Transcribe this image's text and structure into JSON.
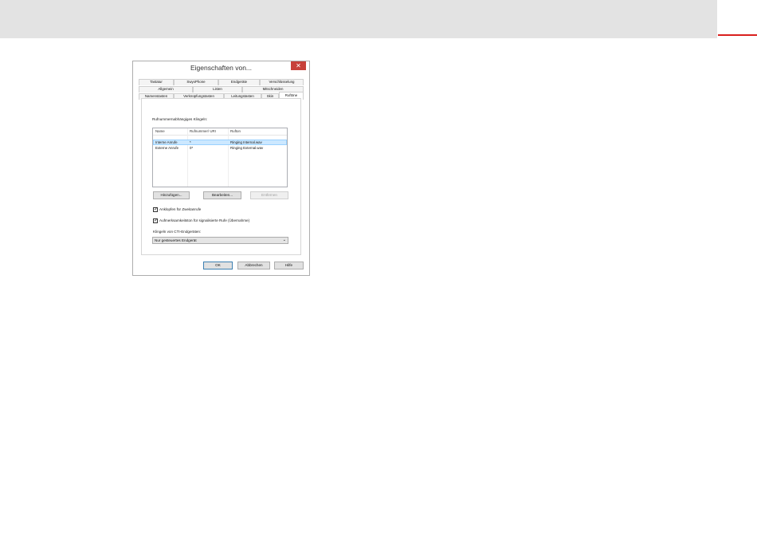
{
  "dialog": {
    "title": "Eigenschaften von...",
    "close_icon": "close-icon"
  },
  "tabs": {
    "row1": [
      "Tastatur",
      "SwyxPhone",
      "Endgeräte",
      "Verschlüsselung"
    ],
    "row2": [
      "Allgemein",
      "Listen",
      "Mitschneiden"
    ],
    "row3": [
      "Namenstasten",
      "Verknüpfungstasten",
      "Leitungstasten",
      "Skin",
      "Ruftöne"
    ],
    "active": "Ruftöne"
  },
  "panel": {
    "group_label": "Rufnummernabhängiges Klingeln:",
    "columns": [
      "Name",
      "Rufnummer/ URI",
      "Rufton"
    ],
    "rows": [
      {
        "name": "Interne Anrufe",
        "number": "*",
        "tone": "Ringing Internal.wav"
      },
      {
        "name": "Externe Anrufe",
        "number": "0*",
        "tone": "Ringing External.wav"
      }
    ],
    "add_label": "Hinzufügen...",
    "edit_label": "Bearbeiten...",
    "remove_label": "Entfernen",
    "knock_label": "Anklopfen für Zweitanrufe",
    "knock_checked": true,
    "attention_label": "Aufmerksamkeitston für signalisierte Rufe (Übernahme)",
    "attention_checked": true,
    "cti_label": "Klingeln von CTI-Endgeräten:",
    "cti_value": "Nur gesteuertes Endgerät"
  },
  "footer": {
    "ok_label": "OK",
    "cancel_label": "Abbrechen",
    "help_label": "Hilfe"
  },
  "colors": {
    "accent": "#d9201e",
    "close_button": "#c7413a",
    "selection": "#cce8ff"
  }
}
